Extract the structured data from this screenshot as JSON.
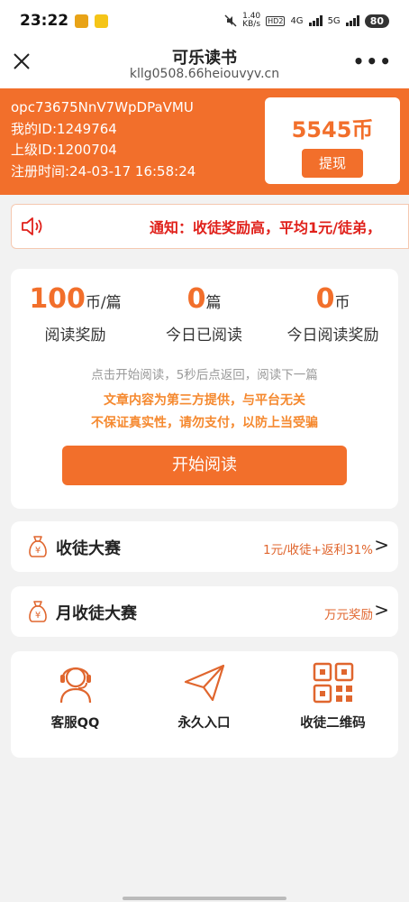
{
  "status_bar": {
    "time": "23:22",
    "net_speed_value": "1.40",
    "net_speed_unit": "KB/s",
    "hd_tag": "HD",
    "hd_sub": "2",
    "sim1": "4G",
    "sim2": "5G",
    "battery": "80"
  },
  "nav": {
    "title": "可乐读书",
    "url": "kllg0508.66heiouvyv.cn",
    "more": "•••"
  },
  "user": {
    "openid": "opc73675NnV7WpDPaVMU",
    "my_id": "我的ID:1249764",
    "parent_id": "上级ID:1200704",
    "register_time": "注册时间:24-03-17 16:58:24"
  },
  "wallet": {
    "coins": "5545币",
    "withdraw_label": "提现"
  },
  "notice": {
    "text": "通知：收徒奖励高，平均1元/徒弟，"
  },
  "stats": [
    {
      "value": "100",
      "unit": "币/篇",
      "label": "阅读奖励"
    },
    {
      "value": "0",
      "unit": "篇",
      "label": "今日已阅读"
    },
    {
      "value": "0",
      "unit": "币",
      "label": "今日阅读奖励"
    }
  ],
  "reading": {
    "hint": "点击开始阅读，5秒后点返回，阅读下一篇",
    "warning_1": "文章内容为第三方提供，与平台无关",
    "warning_2": "不保证真实性，请勿支付，以防上当受骗",
    "start_label": "开始阅读"
  },
  "contests": [
    {
      "name": "收徒大赛",
      "desc": "1元/收徒+返利31%",
      "arrow": ">"
    },
    {
      "name": "月收徒大赛",
      "desc": "万元奖励",
      "arrow": ">"
    }
  ],
  "tools": [
    {
      "label": "客服QQ",
      "icon": "customer-service-icon"
    },
    {
      "label": "永久入口",
      "icon": "paper-plane-icon"
    },
    {
      "label": "收徒二维码",
      "icon": "qr-code-icon"
    }
  ],
  "colors": {
    "accent": "#f26f2b",
    "notice_red": "#e0211b",
    "warning_orange": "#f5892f",
    "background": "#f2f2f2"
  }
}
